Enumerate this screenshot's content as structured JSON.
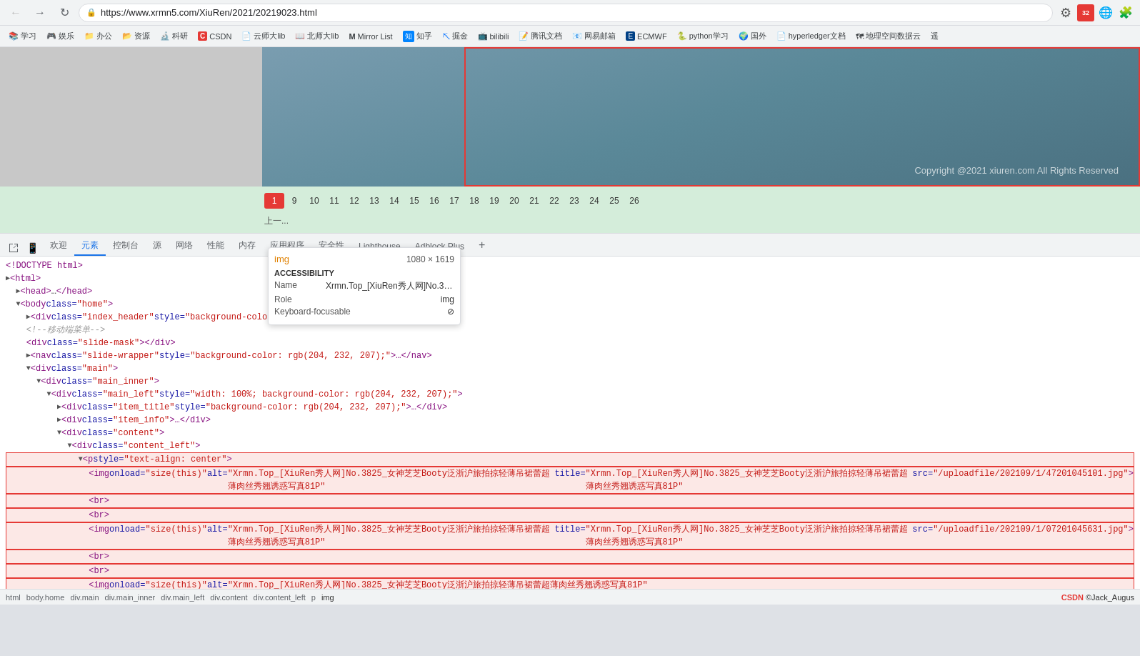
{
  "browser": {
    "url": "https://www.xrmn5.com/XiuRen/2021/20219023.html",
    "nav_back": "←",
    "nav_forward": "→",
    "nav_refresh": "↻",
    "copyright": "Copyright @2021  xiuren.com  All Rights Reserved"
  },
  "bookmarks": [
    {
      "label": "学习",
      "icon": "📚"
    },
    {
      "label": "娱乐",
      "icon": "🎮"
    },
    {
      "label": "办公",
      "icon": "📁"
    },
    {
      "label": "资源",
      "icon": "📂"
    },
    {
      "label": "科研",
      "icon": "🔬"
    },
    {
      "label": "CSDN",
      "icon": "C"
    },
    {
      "label": "云师大lib",
      "icon": "📄"
    },
    {
      "label": "北师大lib",
      "icon": "📖"
    },
    {
      "label": "Mirror List",
      "icon": "M"
    },
    {
      "label": "知乎",
      "icon": "知"
    },
    {
      "label": "掘金",
      "icon": "⛏"
    },
    {
      "label": "bilibili",
      "icon": "📺"
    },
    {
      "label": "腾讯文档",
      "icon": "📝"
    },
    {
      "label": "网易邮箱",
      "icon": "📧"
    },
    {
      "label": "ECMWF",
      "icon": "E"
    },
    {
      "label": "python学习",
      "icon": "🐍"
    },
    {
      "label": "国外",
      "icon": "🌍"
    },
    {
      "label": "hyperledger文档",
      "icon": "📄"
    },
    {
      "label": "地理空间数据云",
      "icon": "🗺"
    },
    {
      "label": "遥",
      "icon": "遥"
    }
  ],
  "tooltip": {
    "tag": "img",
    "size": "1080 × 1619",
    "section": "ACCESSIBILITY",
    "name_label": "Name",
    "name_value": "Xrmn.Top_[XiuRen秀人网]No.3825_女神...",
    "role_label": "Role",
    "role_value": "img",
    "keyboard_label": "Keyboard-focusable",
    "keyboard_icon": "⊘"
  },
  "pagination": {
    "current": 1,
    "pages": [
      "1",
      "9",
      "10",
      "11",
      "12",
      "13",
      "14",
      "15",
      "16",
      "17",
      "18",
      "19",
      "20",
      "21",
      "22",
      "23",
      "24",
      "25",
      "26"
    ],
    "prev_text": "上一..."
  },
  "devtools": {
    "tabs": [
      {
        "label": "欢迎",
        "active": false
      },
      {
        "label": "元素",
        "active": true
      },
      {
        "label": "控制台",
        "active": false
      },
      {
        "label": "源",
        "active": false
      },
      {
        "label": "网络",
        "active": false
      },
      {
        "label": "性能",
        "active": false
      },
      {
        "label": "内存",
        "active": false
      },
      {
        "label": "应用程序",
        "active": false
      },
      {
        "label": "安全性",
        "active": false
      },
      {
        "label": "Lighthouse",
        "active": false
      },
      {
        "label": "Adblock Plus",
        "active": false
      }
    ],
    "code_lines": [
      {
        "indent": 0,
        "content": "<!DOCTYPE html>",
        "type": "text"
      },
      {
        "indent": 0,
        "content": "<html>",
        "type": "tag_expandable"
      },
      {
        "indent": 0,
        "content": "<head>…</head>",
        "type": "tag_collapsed"
      },
      {
        "indent": 0,
        "content": "<body class=\"home\">",
        "type": "tag_expandable"
      },
      {
        "indent": 1,
        "content": "<div class=\"index_header\" style=\"background-color: rgb(204, 232, 207);\">…</div>",
        "type": "tag_collapsed"
      },
      {
        "indent": 1,
        "content": "<!--移动端菜单-->",
        "type": "comment"
      },
      {
        "indent": 1,
        "content": "<div class=\"slide-mask\"></div>",
        "type": "tag"
      },
      {
        "indent": 1,
        "content": "<nav class=\"slide-wrapper\" style=\"background-color: rgb(204, 232, 207);\">…</nav>",
        "type": "tag_collapsed"
      },
      {
        "indent": 1,
        "content": "<div class=\"main\">",
        "type": "tag_expandable"
      },
      {
        "indent": 2,
        "content": "<div class=\"main_inner\">",
        "type": "tag_expandable"
      },
      {
        "indent": 3,
        "content": "<div class=\"main_left\" style=\"width: 100%; background-color: rgb(204, 232, 207);\">",
        "type": "tag_expandable"
      },
      {
        "indent": 4,
        "content": "<div class=\"item_title\" style=\"background-color: rgb(204, 232, 207);\">…</div>",
        "type": "tag_collapsed"
      },
      {
        "indent": 4,
        "content": "<div class=\"item_info\">…</div>",
        "type": "tag_collapsed"
      },
      {
        "indent": 4,
        "content": "<div class=\"content\">",
        "type": "tag_expandable"
      },
      {
        "indent": 5,
        "content": "<div class=\"content_left\">",
        "type": "tag_expandable"
      },
      {
        "indent": 6,
        "content": "<p style=\"text-align: center\">",
        "type": "tag_expandable",
        "selected": true
      },
      {
        "indent": 7,
        "content": "<img onload=\"size(this)\" alt=\"Xrmn.Top_[XiuRen秀人网]No.3825_女神芝芝Booty泛浙沪旅拍掠轻薄吊裙蕾超薄肉丝秀翘诱惑写真81P\" title=\"Xrmn.Top_[XiuRen秀人网]No.3825_女神芝芝Booty泛浙沪旅拍掠轻薄吊裙蕾超薄肉丝秀翘诱惑写真81P\" src=\"/uploadfile/202109/1/47201045101.jpg\">",
        "type": "tag",
        "selected": true
      },
      {
        "indent": 7,
        "content": "<br>",
        "type": "tag"
      },
      {
        "indent": 7,
        "content": "<br>",
        "type": "tag"
      },
      {
        "indent": 7,
        "content": "<img onload=\"size(this)\" alt=\"Xrmn.Top_[XiuRen秀人网]No.3825_女神芝芝Booty泛浙沪旅拍掠轻薄吊裙蕾超薄肉丝秀翘诱惑写真81P\" title=\"Xrmn.Top_[XiuRen秀人网]No.3825_女神芝芝Booty泛浙沪旅拍掠轻薄吊裙蕾超薄肉丝秀翘诱惑写真81P\" src=\"/uploadfile/202109/1/07201045631.jpg\">",
        "type": "tag",
        "selected": true
      },
      {
        "indent": 7,
        "content": "<br>",
        "type": "tag"
      },
      {
        "indent": 7,
        "content": "<br>",
        "type": "tag"
      },
      {
        "indent": 7,
        "content": "<img onload=\"size(this)\" alt=\"Xrmn.Top_[XiuRen秀人网]No.3825_女神芝芝Booty泛浙沪旅拍掠轻薄吊裙蕾超薄肉丝秀翘诱惑写真81P\"",
        "type": "tag",
        "selected": true
      }
    ],
    "breadcrumb": [
      "html",
      "body.home",
      "div.main",
      "div.main_inner",
      "div.main_left",
      "div.content",
      "div.content_left",
      "p",
      "img"
    ],
    "footer_text": "CSDN ©Jack_Augus"
  }
}
